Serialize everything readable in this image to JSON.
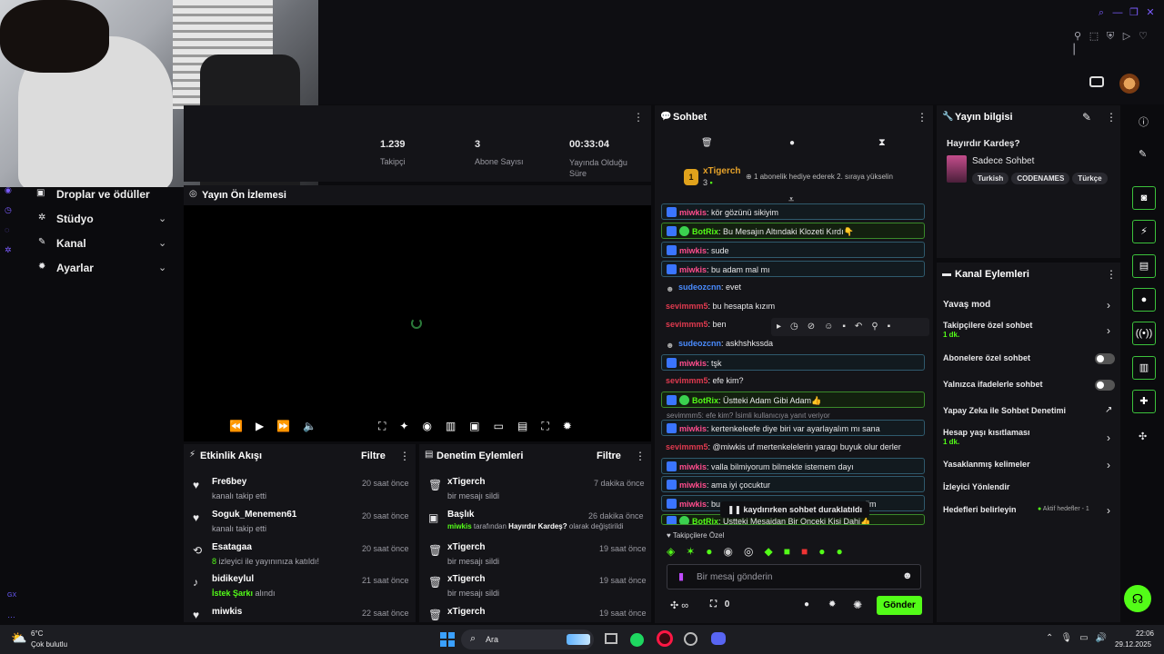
{
  "stats": [
    {
      "value": "1.239",
      "label": "Takipçi"
    },
    {
      "value": "3",
      "label": "Abone Sayısı"
    },
    {
      "value": "00:33:04",
      "label": "Yayında Olduğu Süre"
    }
  ],
  "nav": {
    "drops": "Droplar ve ödüller",
    "studio": "Stüdyo",
    "channel": "Kanal",
    "settings": "Ayarlar"
  },
  "preview": {
    "title": "Yayın Ön İzlemesi"
  },
  "activity": {
    "title": "Etkinlik Akışı",
    "filter": "Filtre",
    "items": [
      {
        "name": "Fre6bey",
        "sub": "kanalı takip etti",
        "time": "20 saat önce"
      },
      {
        "name": "Soguk_Menemen61",
        "sub": "kanalı takip etti",
        "time": "20 saat önce"
      },
      {
        "name": "Esatagaa",
        "sub_pre": "8",
        "sub": " izleyici ile yayınınıza katıldı!",
        "time": "20 saat önce"
      },
      {
        "name": "bidikeylul",
        "sub_pre": "İstek Şarkı",
        "sub": " alındı",
        "time": "21 saat önce"
      },
      {
        "name": "miwkis",
        "sub": "",
        "time": "22 saat önce"
      }
    ]
  },
  "moderation": {
    "title": "Denetim Eylemleri",
    "filter": "Filtre",
    "items": [
      {
        "name": "xTigerch",
        "sub": "bir mesajı sildi",
        "time": "7 dakika önce"
      },
      {
        "name": "Başlık",
        "sub_user": "miwkis",
        "sub_mid": " tarafından ",
        "sub_bold": "Hayırdır Kardeş?",
        "sub_end": " olarak değiştirildi",
        "time": "26 dakika önce"
      },
      {
        "name": "xTigerch",
        "sub": "bir mesajı sildi",
        "time": "19 saat önce"
      },
      {
        "name": "xTigerch",
        "sub": "bir mesajı sildi",
        "time": "19 saat önce"
      },
      {
        "name": "xTigerch",
        "sub": "",
        "time": "19 saat önce"
      }
    ]
  },
  "chat": {
    "title": "Sohbet",
    "pinned_user": "xTigerch",
    "pinned_count": "3",
    "pinned_text": "1 abonelik hediye ederek 2. sıraya yükselin",
    "messages": [
      {
        "user": "miwkis",
        "text": ": kör gözünü sikiyim"
      },
      {
        "user": "BotRix",
        "text": ": Bu Mesajın Altındaki Klozeti Kırdı👇"
      },
      {
        "user": "miwkis",
        "text": ": sude"
      },
      {
        "user": "miwkis",
        "text": ": bu adam mal mı"
      },
      {
        "user": "sudeozcnn",
        "text": ": evet"
      },
      {
        "user": "sevimmm5",
        "text": ": bu hesapta kızım"
      },
      {
        "user": "sevimmm5",
        "text": ": ben"
      },
      {
        "user": "sudeozcnn",
        "text": ": askhshkssda"
      },
      {
        "user": "miwkis",
        "text": ": tşk"
      },
      {
        "user": "sevimmm5",
        "text": ": efe kim?"
      },
      {
        "user": "BotRix",
        "text": ": Üstteki Adam Gibi Adam👍"
      },
      {
        "user": "miwkis",
        "text": ": kertenkeleefe diye biri var ayarlayalım mı sana"
      },
      {
        "user": "sevimmm5",
        "text": ": @miwkis uf mertenkelelerin yaragı buyuk olur derler"
      },
      {
        "user": "miwkis",
        "text": ": valla bilmiyorum bilmekte istemem dayı"
      },
      {
        "user": "miwkis",
        "text": ": ama iyi çocuktur"
      },
      {
        "user": "miwkis",
        "text": ": bu"
      },
      {
        "user": "BotRix",
        "text": ": Üstteki Mesajdan Bir Önceki Kişi Dahi👍"
      }
    ],
    "reply_note": "sevimmm5: efe kim? İsimli kullanıcıya yanıt veriyor",
    "paused": "kaydırırken sohbet duraklatıldı",
    "paused_tail": "edim",
    "followers_only": "Takipçilere Özel",
    "input_placeholder": "Bir mesaj gönderin",
    "gift_count": "0",
    "send": "Gönder"
  },
  "stream_info": {
    "title": "Yayın bilgisi",
    "stream_title": "Hayırdır Kardeş?",
    "category": "Sadece Sohbet",
    "tags": [
      "Turkish",
      "CODENAMES",
      "Türkçe"
    ]
  },
  "channel_actions": {
    "title": "Kanal Eylemleri",
    "items": [
      {
        "label": "Yavaş mod",
        "kind": "arrow"
      },
      {
        "label": "Takipçilere özel sohbet",
        "sub": "1 dk.",
        "kind": "arrow"
      },
      {
        "label": "Abonelere özel sohbet",
        "kind": "toggle"
      },
      {
        "label": "Yalnızca ifadelerle sohbet",
        "kind": "toggle"
      },
      {
        "label": "Yapay Zeka ile Sohbet Denetimi",
        "kind": "link"
      },
      {
        "label": "Hesap yaşı kısıtlaması",
        "sub": "1 dk.",
        "kind": "arrow"
      },
      {
        "label": "Yasaklanmış kelimeler",
        "kind": "arrow"
      },
      {
        "label": "İzleyici Yönlendir",
        "kind": "none"
      },
      {
        "label": "Hedefleri belirleyin",
        "extra": "Aktif hedefler - 1",
        "kind": "arrow"
      }
    ]
  },
  "taskbar": {
    "temp": "6°C",
    "weather": "Çok bulutlu",
    "search": "Ara",
    "time": "22:06",
    "date": "29.12.2025",
    "gx": "GX"
  },
  "colors": {
    "accent": "#53fc18",
    "panel": "#141418",
    "bg": "#0b0b0e"
  }
}
